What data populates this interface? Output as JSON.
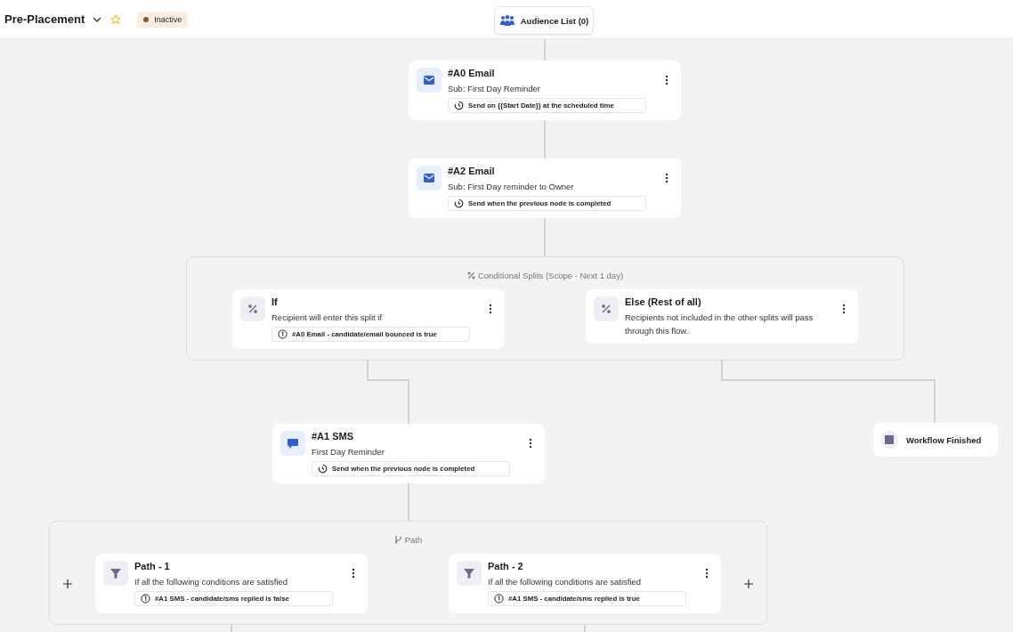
{
  "header": {
    "title": "Pre-Placement",
    "starred": false,
    "status": {
      "label": "Inactive",
      "kind": "inactive"
    }
  },
  "audience_button": {
    "label": "Audience List (0)"
  },
  "flow": [
    {
      "kind": "email",
      "title": "#A0 Email",
      "subtitle": "Sub: First Day Reminder",
      "rule": {
        "kind": "timer",
        "text": "Send on {{Start Date}} at the scheduled time"
      }
    },
    {
      "kind": "email",
      "title": "#A2 Email",
      "subtitle": "Sub: First Day reminder to Owner",
      "rule": {
        "kind": "timer",
        "text": "Send when the previous node is completed"
      }
    },
    {
      "kind": "split_group",
      "label": "Conditional Splits (Scope - Next 1 day)",
      "branches": [
        {
          "kind": "split",
          "title": "If",
          "subtitle": "Recipient will enter this split if",
          "rule": {
            "kind": "condition",
            "text": "#A0 Email - candidate/email bounced is true"
          }
        },
        {
          "kind": "split",
          "title": "Else (Rest of all)",
          "subtitle": "Recipients not included in the other splits will pass through this flow."
        }
      ]
    },
    {
      "kind": "sms",
      "title": "#A1 SMS",
      "subtitle": "First Day Reminder",
      "rule": {
        "kind": "timer",
        "text": "Send when the previous node is completed"
      }
    },
    {
      "kind": "finished",
      "title": "Workflow Finished"
    },
    {
      "kind": "path_group",
      "label": "Path",
      "branches": [
        {
          "kind": "path",
          "title": "Path - 1",
          "subtitle": "If all the following conditions are satisfied",
          "rule": {
            "kind": "condition",
            "text": "#A1 SMS - candidate/sms replied is false"
          }
        },
        {
          "kind": "path",
          "title": "Path - 2",
          "subtitle": "If all the following conditions are satisfied",
          "rule": {
            "kind": "condition",
            "text": "#A1 SMS - candidate/sms replied is true"
          }
        }
      ]
    }
  ]
}
